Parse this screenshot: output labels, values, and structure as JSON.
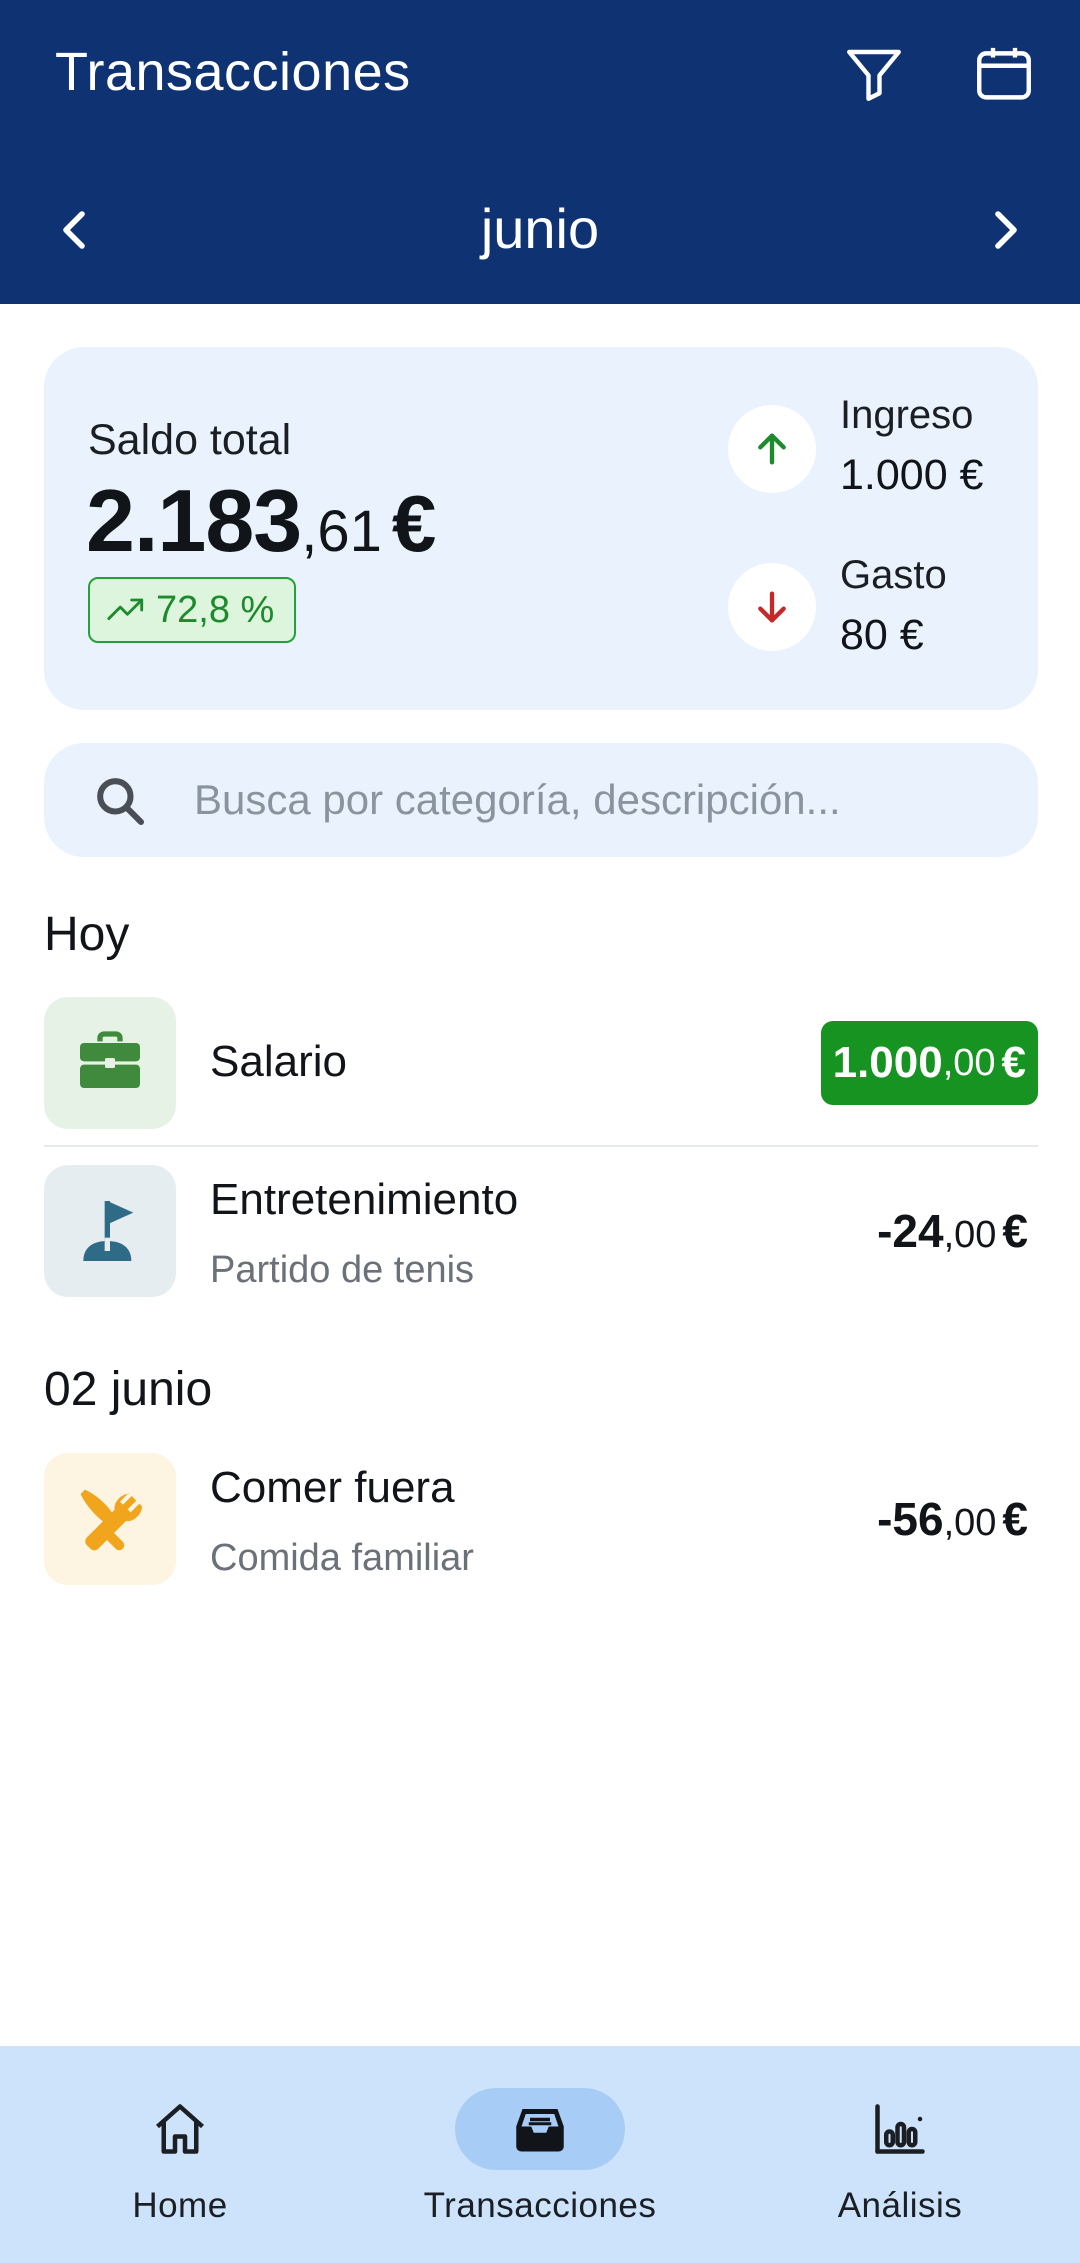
{
  "header": {
    "title": "Transacciones",
    "filter_icon": "filter-icon",
    "calendar_icon": "calendar-icon"
  },
  "month_nav": {
    "month": "junio",
    "prev_icon": "chevron-left-icon",
    "next_icon": "chevron-right-icon"
  },
  "summary": {
    "balance_label": "Saldo total",
    "balance_int": "2.183",
    "balance_dec": ",61",
    "balance_currency": "€",
    "trend": "72,8 %",
    "income_label": "Ingreso",
    "income_value": "1.000 €",
    "expense_label": "Gasto",
    "expense_value": "80 €"
  },
  "search": {
    "placeholder": "Busca por categoría, descripción..."
  },
  "groups": [
    {
      "title": "Hoy",
      "transactions": [
        {
          "category": "Salario",
          "description": "",
          "amount_int": "1.000",
          "amount_dec": ",00",
          "currency": "€",
          "type": "income",
          "icon": "briefcase-icon"
        },
        {
          "category": "Entretenimiento",
          "description": "Partido de tenis",
          "amount_int": "-24",
          "amount_dec": ",00",
          "currency": "€",
          "type": "expense",
          "icon": "golf-flag-icon"
        }
      ]
    },
    {
      "title": "02 junio",
      "transactions": [
        {
          "category": "Comer fuera",
          "description": "Comida familiar",
          "amount_int": "-56",
          "amount_dec": ",00",
          "currency": "€",
          "type": "expense",
          "icon": "utensils-icon"
        }
      ]
    }
  ],
  "bottom_nav": [
    {
      "label": "Home",
      "icon": "home-icon",
      "active": false
    },
    {
      "label": "Transacciones",
      "icon": "inbox-icon",
      "active": true
    },
    {
      "label": "Análisis",
      "icon": "bar-chart-icon",
      "active": false
    }
  ],
  "colors": {
    "header_bg": "#0f3273",
    "card_bg": "#eaf3fd",
    "income_green": "#169320",
    "expense_red": "#c62828",
    "nav_bg": "#cde2fb",
    "nav_active": "#a7cdf6"
  }
}
